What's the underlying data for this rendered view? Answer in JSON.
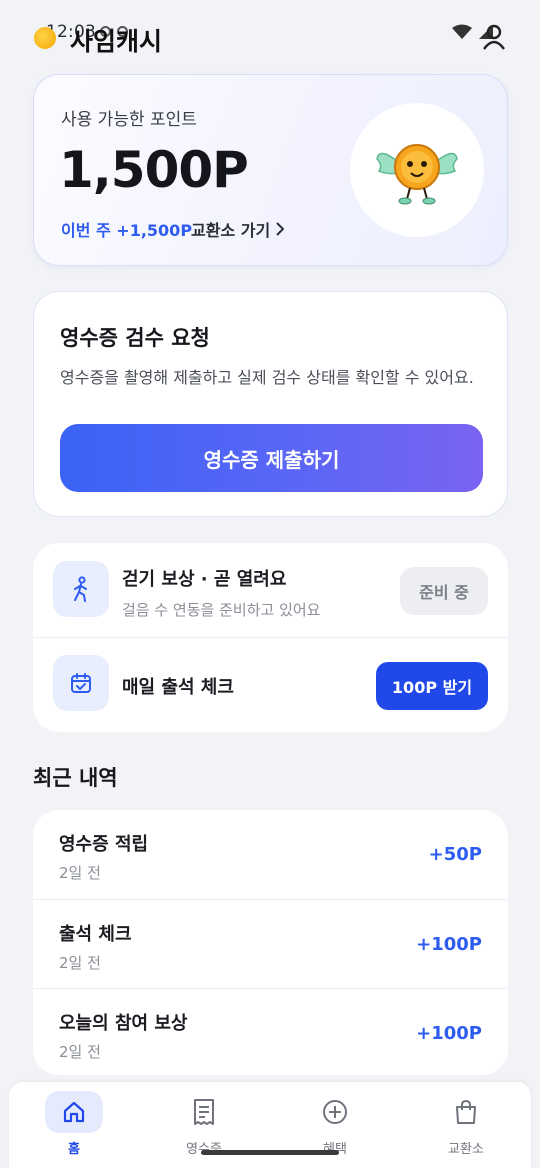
{
  "status_bar": {
    "time": "12:03"
  },
  "header": {
    "title": "사임캐시",
    "logo_icon": "coin-icon",
    "profile_icon": "user-icon"
  },
  "points_card": {
    "label": "사용 가능한 포인트",
    "value": "1,500P",
    "weekly": "이번 주 +1,500P",
    "exchange_link": "교환소 가기",
    "mascot": "winged-coin-mascot"
  },
  "receipt_card": {
    "title": "영수증 검수 요청",
    "description": "영수증을 촬영해 제출하고 실제 검수 상태를 확인할 수 있어요.",
    "button": "영수증 제출하기"
  },
  "tasks": {
    "walking": {
      "title": "걷기 보상 · 곧 열려요",
      "subtitle": "걸음 수 연동을 준비하고 있어요",
      "badge": "준비 중",
      "icon": "walking-icon"
    },
    "attendance": {
      "title": "매일 출석 체크",
      "button": "100P 받기",
      "icon": "calendar-check-icon"
    }
  },
  "recent": {
    "title": "최근 내역",
    "items": [
      {
        "name": "영수증 적립",
        "time": "2일 전",
        "amount": "+50P"
      },
      {
        "name": "출석 체크",
        "time": "2일 전",
        "amount": "+100P"
      },
      {
        "name": "오늘의 참여 보상",
        "time": "2일 전",
        "amount": "+100P"
      }
    ]
  },
  "nav": {
    "items": [
      {
        "label": "홈",
        "icon": "home-icon",
        "active": true
      },
      {
        "label": "영수증",
        "icon": "receipt-icon",
        "active": false
      },
      {
        "label": "혜택",
        "icon": "plus-circle-icon",
        "active": false
      },
      {
        "label": "교환소",
        "icon": "shopping-bag-icon",
        "active": false
      }
    ]
  },
  "colors": {
    "accent": "#2148e8",
    "point_blue": "#2f5cf0",
    "background": "#f2f3f6"
  }
}
